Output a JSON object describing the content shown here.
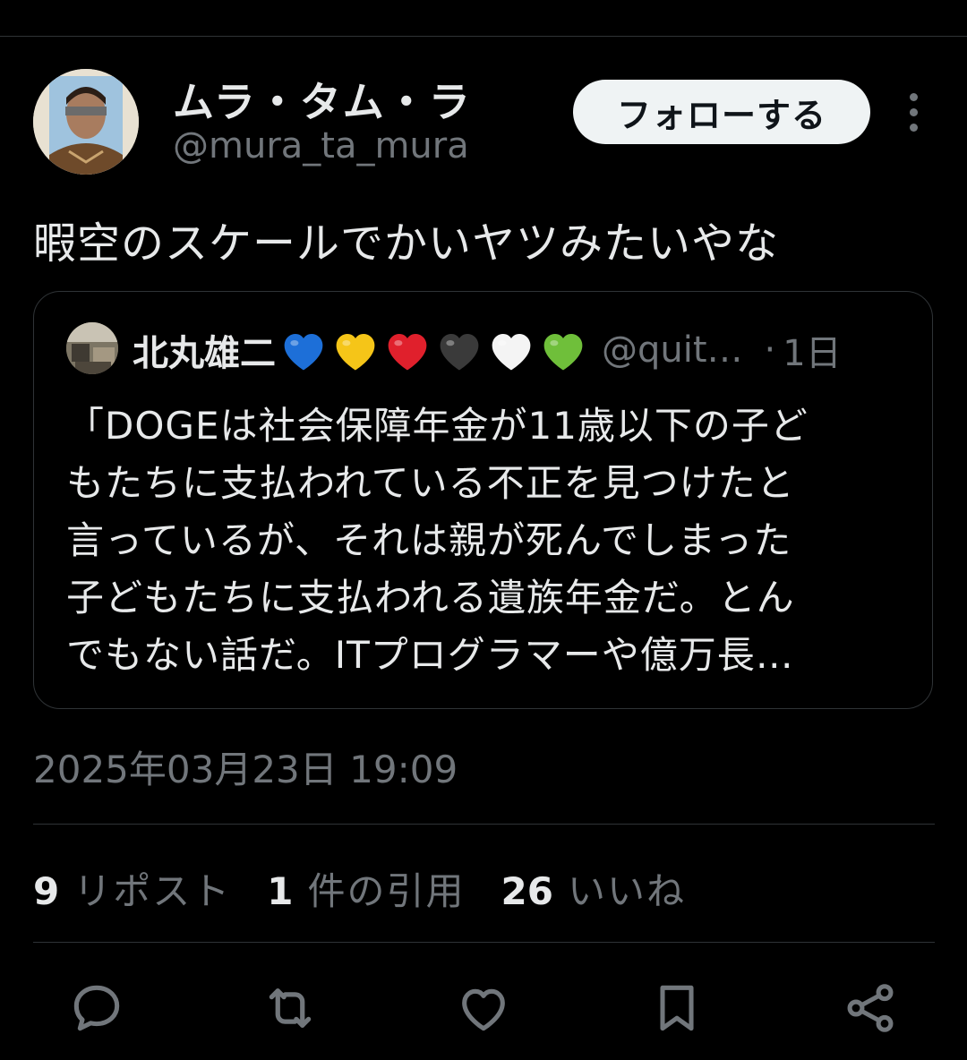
{
  "user": {
    "display_name": "ムラ・タム・ラ",
    "handle": "@mura_ta_mura"
  },
  "follow_label": "フォローする",
  "tweet_text": "暇空のスケールでかいヤツみたいやな",
  "quote": {
    "name": "北丸雄二",
    "hearts": [
      {
        "name": "blue-heart-icon",
        "color": "#1d6fd8"
      },
      {
        "name": "yellow-heart-icon",
        "color": "#f5c518"
      },
      {
        "name": "red-heart-icon",
        "color": "#e0202c"
      },
      {
        "name": "black-heart-icon",
        "color": "#3a3a3a"
      },
      {
        "name": "white-heart-icon",
        "color": "#f4f4f4"
      },
      {
        "name": "green-heart-icon",
        "color": "#6fbf3a"
      }
    ],
    "handle": "@quit…",
    "dot": "·",
    "time": "1日",
    "lines": [
      "「DOGEは社会保障年金が11歳以下の子ど",
      "もたちに支払われている不正を見つけたと",
      "言っているが、それは親が死んでしまった",
      "子どもたちに支払われる遺族年金だ。とん",
      "でもない話だ。ITプログラマーや億万長…"
    ]
  },
  "timestamp": "2025年03月23日 19:09",
  "stats": {
    "reposts": {
      "count": "9",
      "label": "リポスト"
    },
    "quotes": {
      "count": "1",
      "label": "件の引用"
    },
    "likes": {
      "count": "26",
      "label": "いいね"
    }
  },
  "actions": [
    "reply-icon",
    "repost-icon",
    "like-icon",
    "bookmark-icon",
    "share-icon"
  ],
  "colors": {
    "background": "#000000",
    "text": "#e7e9ea",
    "secondary": "#71767b",
    "border": "#2f3336",
    "follow_bg": "#eff3f4"
  }
}
